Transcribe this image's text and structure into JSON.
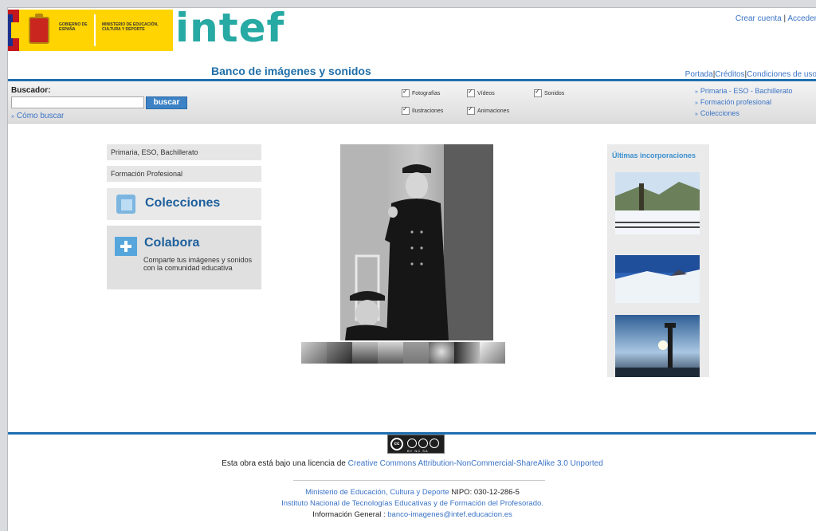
{
  "header": {
    "gov_label": "GOBIERNO DE ESPAÑA",
    "ministry_label": "MINISTERIO DE EDUCACIÓN, CULTURA Y DEPORTE",
    "brand": "intef",
    "site_title": "Banco de imágenes y sonidos",
    "account": {
      "create": "Crear cuenta",
      "sep": "|",
      "login": "Acceder"
    },
    "top_links": [
      {
        "label": "Portada"
      },
      {
        "label": "Créditos"
      },
      {
        "label": "Condiciones de uso"
      }
    ]
  },
  "search": {
    "label": "Buscador:",
    "value": "",
    "button": "buscar",
    "help": "Cómo buscar",
    "filters": [
      {
        "label": "Fotografías",
        "checked": true
      },
      {
        "label": "Vídeos",
        "checked": true
      },
      {
        "label": "Sonidos",
        "checked": true
      },
      {
        "label": "Ilustraciones",
        "checked": true
      },
      {
        "label": "Animaciones",
        "checked": true
      }
    ],
    "side_links": [
      "Primaria - ESO - Bachillerato",
      "Formación profesional",
      "Colecciones"
    ]
  },
  "left": {
    "item1": "Primaria, ESO, Bachillerato",
    "item2": "Formación Profesional",
    "colecciones": "Colecciones",
    "colabora": "Colabora",
    "colabora_desc": "Comparte tus imágenes y sonidos con la comunidad educativa"
  },
  "right": {
    "heading": "Últimas incorporaciones"
  },
  "footer": {
    "cc_caption": "BY NC SA",
    "license_prefix": "Esta obra está bajo una licencia de",
    "license_link": "Creative Commons Attribution-NonCommercial-ShareAlike 3.0 Unported",
    "ministry": "Ministerio de Educación, Cultura y Deporte",
    "nipo": "NIPO: 030-12-286-5",
    "institute": "Instituto Nacional de Tecnologías Educativas y de Formación del Profesorado.",
    "info_label": "Información General :",
    "email": "banco-imagenes@intef.educacion.es"
  },
  "colors": {
    "accent": "#1f6fb0",
    "link": "#3a73c5",
    "brand": "#27a9a4"
  }
}
